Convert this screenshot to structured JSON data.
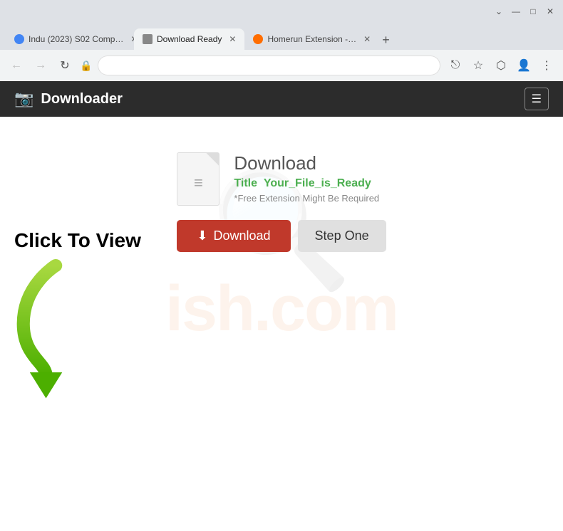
{
  "window": {
    "controls": {
      "chevron_down": "⌄",
      "minimize": "—",
      "restore": "□",
      "close": "✕"
    }
  },
  "browser": {
    "tabs": [
      {
        "id": "tab1",
        "label": "Indu (2023) S02 Comp…",
        "active": false,
        "favicon_type": "blue"
      },
      {
        "id": "tab2",
        "label": "Download Ready",
        "active": true,
        "favicon_type": "default"
      },
      {
        "id": "tab3",
        "label": "Homerun Extension -…",
        "active": false,
        "favicon_type": "orange"
      }
    ],
    "new_tab_label": "+",
    "address": "",
    "nav": {
      "back": "←",
      "forward": "→",
      "reload": "↻",
      "lock": "🔒"
    },
    "toolbar": {
      "share": "⎋",
      "star": "☆",
      "cast": "⬡",
      "account": "👤",
      "menu": "⋮"
    }
  },
  "navbar": {
    "brand": "Downloader",
    "brand_icon": "📷",
    "hamburger": "☰"
  },
  "download_card": {
    "title": "Download",
    "title_label": "Title",
    "filename": "Your_File_is_Ready",
    "note": "*Free Extension Might Be Required",
    "download_btn": "Download",
    "step_btn": "Step One",
    "download_icon": "⬇"
  },
  "watermark": {
    "text": "ish.com"
  },
  "click_to_view": {
    "label": "Click To View"
  }
}
